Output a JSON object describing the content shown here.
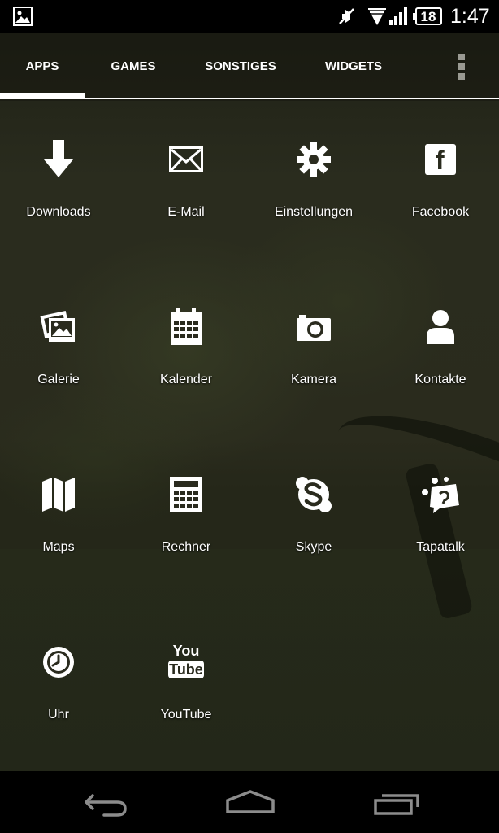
{
  "status_bar": {
    "time": "1:47",
    "battery": "18",
    "icons": [
      "gallery-notification-icon",
      "mute-icon",
      "wifi-icon",
      "signal-icon",
      "battery-icon"
    ]
  },
  "tabs": [
    {
      "label": "APPS",
      "active": true
    },
    {
      "label": "GAMES",
      "active": false
    },
    {
      "label": "SONSTIGES",
      "active": false
    },
    {
      "label": "WIDGETS",
      "active": false
    }
  ],
  "overflow_menu_icon": "overflow-menu-icon",
  "apps": [
    {
      "label": "Downloads",
      "icon": "download-icon"
    },
    {
      "label": "E-Mail",
      "icon": "mail-icon"
    },
    {
      "label": "Einstellungen",
      "icon": "gear-icon"
    },
    {
      "label": "Facebook",
      "icon": "facebook-icon"
    },
    {
      "label": "Galerie",
      "icon": "gallery-icon"
    },
    {
      "label": "Kalender",
      "icon": "calendar-icon"
    },
    {
      "label": "Kamera",
      "icon": "camera-icon"
    },
    {
      "label": "Kontakte",
      "icon": "contact-icon"
    },
    {
      "label": "Maps",
      "icon": "map-icon"
    },
    {
      "label": "Rechner",
      "icon": "calculator-icon"
    },
    {
      "label": "Skype",
      "icon": "skype-icon"
    },
    {
      "label": "Tapatalk",
      "icon": "tapatalk-icon"
    },
    {
      "label": "Uhr",
      "icon": "clock-icon"
    },
    {
      "label": "YouTube",
      "icon": "youtube-icon"
    }
  ],
  "youtube_logo": {
    "line1": "You",
    "line2": "Tube"
  },
  "facebook_letter": "f",
  "navigation": [
    "back-icon",
    "home-icon",
    "recents-icon"
  ],
  "colors": {
    "icon": "#ffffff",
    "text": "#ffffff",
    "bars": "#000000"
  }
}
